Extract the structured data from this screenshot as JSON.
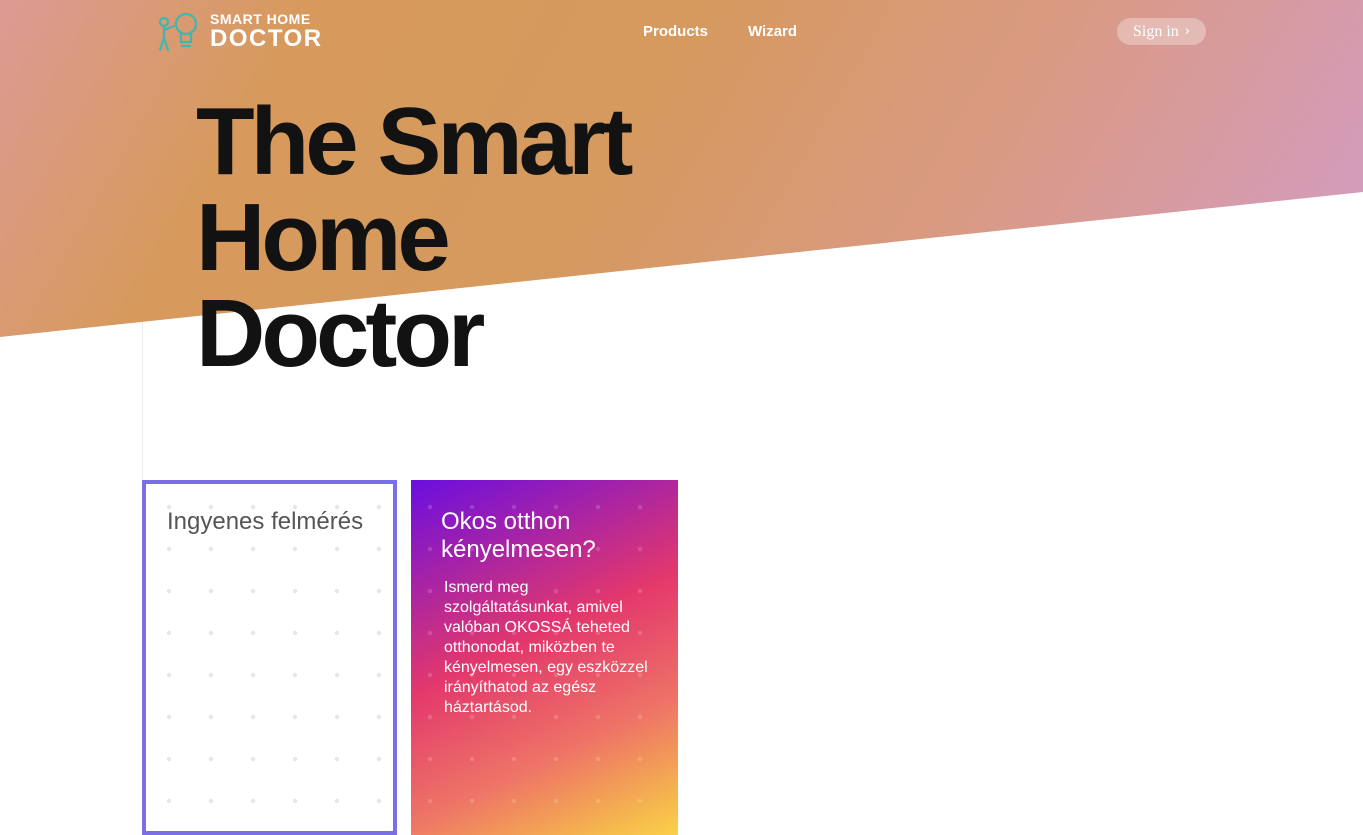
{
  "brand": {
    "line1": "SMART HOME",
    "line2": "DOCTOR",
    "icon": "lightbulb-logo-icon"
  },
  "nav": {
    "items": [
      {
        "label": "Products"
      },
      {
        "label": "Wizard"
      }
    ]
  },
  "signin": {
    "label": "Sign in",
    "chevron": "›"
  },
  "hero": {
    "title_lines": [
      "The Smart",
      "Home",
      "Doctor"
    ]
  },
  "cards": [
    {
      "title": "Ingyenes felmérés",
      "border_color": "#7b6fe6"
    },
    {
      "title": "Okos otthon kényelmesen?",
      "body": "Ismerd meg szolgáltatásunkat, amivel valóban OKOSSÁ teheted otthonodat, miközben te kényelmesen, egy eszközzel irányíthatod az egész háztartásod."
    }
  ],
  "colors": {
    "hero_gradient_start": "#dc9a94",
    "hero_gradient_mid": "#d6995e",
    "hero_gradient_end": "#d39cc8",
    "card_gradient_start": "#6a0ee0",
    "card_gradient_end": "#fbd04a",
    "headline": "#121212"
  }
}
